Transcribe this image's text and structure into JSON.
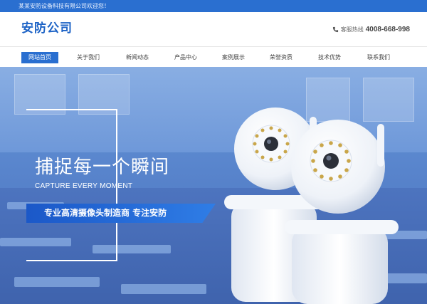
{
  "topbar": {
    "welcome": "某某安防设备科技有限公司欢迎您！"
  },
  "header": {
    "logo": "安防公司",
    "hotline_label": "客服热线",
    "hotline_number": "4008-668-998"
  },
  "nav": {
    "items": [
      {
        "label": "网站首页",
        "active": true
      },
      {
        "label": "关于我们"
      },
      {
        "label": "新闻动态"
      },
      {
        "label": "产品中心"
      },
      {
        "label": "案例展示"
      },
      {
        "label": "荣誉资质"
      },
      {
        "label": "技术优势"
      },
      {
        "label": "联系我们"
      }
    ]
  },
  "banner": {
    "headline": "捕捉每一个瞬间",
    "subline": "CAPTURE EVERY MOMENT",
    "slogan": "专业高清摄像头制造商  专注安防"
  },
  "colors": {
    "brand": "#2a6fd0",
    "logo": "#1d63c6",
    "slogan": "#1b58c8"
  }
}
